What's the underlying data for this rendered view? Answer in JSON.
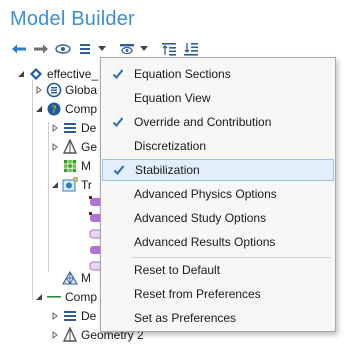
{
  "panel": {
    "title": "Model Builder"
  },
  "toolbar": {
    "buttons": [
      {
        "icon": "arrow-left-icon"
      },
      {
        "icon": "arrow-right-icon"
      },
      {
        "icon": "eye-icon"
      },
      {
        "icon": "list-icon"
      },
      {
        "icon": "filter-icon"
      },
      {
        "icon": "expand-all-icon"
      },
      {
        "icon": "collapse-all-icon"
      }
    ]
  },
  "tree": {
    "root": "effective_",
    "global": "Globa",
    "comp1": "Comp",
    "def1": "De",
    "geom1": "Ge",
    "mat1": "M",
    "tr": "Tr",
    "mesh1": "M",
    "comp2": "Comp",
    "def2": "De",
    "geom2": "Geometry 2"
  },
  "menu": {
    "items": [
      {
        "label": "Equation Sections",
        "checked": true,
        "highlighted": false
      },
      {
        "label": "Equation View",
        "checked": false,
        "highlighted": false
      },
      {
        "label": "Override and Contribution",
        "checked": true,
        "highlighted": false
      },
      {
        "label": "Discretization",
        "checked": false,
        "highlighted": false
      },
      {
        "label": "Stabilization",
        "checked": true,
        "highlighted": true
      },
      {
        "label": "Advanced Physics Options",
        "checked": false,
        "highlighted": false
      },
      {
        "label": "Advanced Study Options",
        "checked": false,
        "highlighted": false
      },
      {
        "label": "Advanced Results Options",
        "checked": false,
        "highlighted": false
      },
      {
        "label": "Reset to Default",
        "checked": false,
        "highlighted": false
      },
      {
        "label": "Reset from Preferences",
        "checked": false,
        "highlighted": false
      },
      {
        "label": "Set as Preferences",
        "checked": false,
        "highlighted": false
      }
    ]
  },
  "colors": {
    "accent": "#3a8fd6",
    "highlight": "#e3eefb",
    "check": "#2a6db5"
  }
}
